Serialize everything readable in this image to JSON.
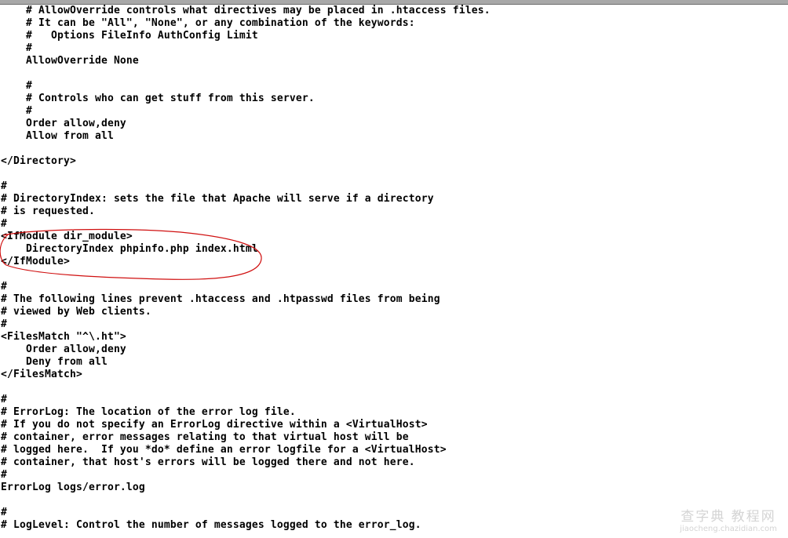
{
  "editor": {
    "lines": [
      "    # AllowOverride controls what directives may be placed in .htaccess files.",
      "    # It can be \"All\", \"None\", or any combination of the keywords:",
      "    #   Options FileInfo AuthConfig Limit",
      "    #",
      "    AllowOverride None",
      "",
      "    #",
      "    # Controls who can get stuff from this server.",
      "    #",
      "    Order allow,deny",
      "    Allow from all",
      "",
      "</Directory>",
      "",
      "#",
      "# DirectoryIndex: sets the file that Apache will serve if a directory",
      "# is requested.",
      "#",
      "<IfModule dir_module>",
      "    DirectoryIndex phpinfo.php index.html",
      "</IfModule>",
      "",
      "#",
      "# The following lines prevent .htaccess and .htpasswd files from being",
      "# viewed by Web clients.",
      "#",
      "<FilesMatch \"^\\.ht\">",
      "    Order allow,deny",
      "    Deny from all",
      "</FilesMatch>",
      "",
      "#",
      "# ErrorLog: The location of the error log file.",
      "# If you do not specify an ErrorLog directive within a <VirtualHost>",
      "# container, error messages relating to that virtual host will be",
      "# logged here.  If you *do* define an error logfile for a <VirtualHost>",
      "# container, that host's errors will be logged there and not here.",
      "#",
      "ErrorLog logs/error.log",
      "",
      "#",
      "# LogLevel: Control the number of messages logged to the error_log."
    ],
    "annotation_color": "#d01010"
  },
  "watermark": {
    "title": "查字典 教程网",
    "url": "jiaocheng.chazidian.com"
  }
}
